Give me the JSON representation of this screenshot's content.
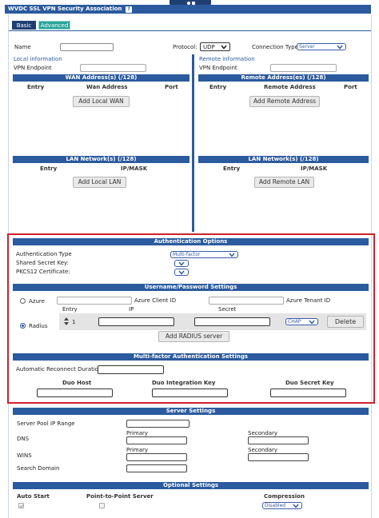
{
  "title": "WVDC SSL VPN Security Association",
  "help_glyph": "?",
  "colors": {
    "accent": "#2b5a9e",
    "highlight": "#d0202a"
  },
  "tabs": [
    {
      "label": "Basic"
    },
    {
      "label": "Advanced"
    }
  ],
  "top": {
    "name_label": "Name",
    "protocol_label": "Protocol:",
    "protocol_value": "UDP",
    "conn_type_label": "Connection Type",
    "conn_type_value": "Server"
  },
  "local": {
    "title": "Local information",
    "vpn_endpoint_label": "VPN Endpoint",
    "wan_header": "WAN Address(s) (/128)",
    "wan_cols": [
      "Entry",
      "Wan Address",
      "Port"
    ],
    "add_wan": "Add Local WAN",
    "lan_header": "LAN Network(s) (/128)",
    "lan_cols": [
      "Entry",
      "IP/MASK"
    ],
    "add_lan": "Add Local LAN"
  },
  "remote": {
    "title": "Remote information",
    "vpn_endpoint_label": "VPN Endpoint",
    "addr_header": "Remote Address(es) (/128)",
    "addr_cols": [
      "Entry",
      "Remote Address",
      "Port"
    ],
    "add_addr": "Add Remote Address",
    "lan_header": "LAN Network(s) (/128)",
    "lan_cols": [
      "Entry",
      "IP/MASK"
    ],
    "add_lan": "Add Remote LAN"
  },
  "auth": {
    "header": "Authentication Options",
    "type_label": "Authentication Type",
    "type_value": "Multi-factor",
    "secret_label": "Shared Secret Key:",
    "pkcs_label": "PKCS12 Certificate:"
  },
  "userpass": {
    "header": "Username/Password Settings",
    "azure_label": "Azure",
    "azure_client_label": "Azure Client ID",
    "azure_tenant_label": "Azure Tenant ID",
    "radius_label": "Radius",
    "cols": [
      "Entry",
      "IP",
      "Secret"
    ],
    "row_entry": "1",
    "chap_value": "CHAP",
    "delete": "Delete",
    "add_radius": "Add RADIUS server"
  },
  "mfa": {
    "header": "Multi-factor Authentication Settings",
    "reconnect_label": "Automatic Reconnect Duration",
    "cols": [
      "Duo Host",
      "Duo Integration Key",
      "Duo Secret Key"
    ]
  },
  "server": {
    "header": "Server Settings",
    "pool_label": "Server Pool IP Range",
    "dns_label": "DNS",
    "wins_label": "WINS",
    "primary_label": "Primary",
    "secondary_label": "Secondary",
    "search_domain_label": "Search Domain"
  },
  "optional": {
    "header": "Optional Settings",
    "auto_start": "Auto Start",
    "ptp": "Point-to-Point Server",
    "compression": "Compression",
    "compression_value": "Disabled"
  }
}
